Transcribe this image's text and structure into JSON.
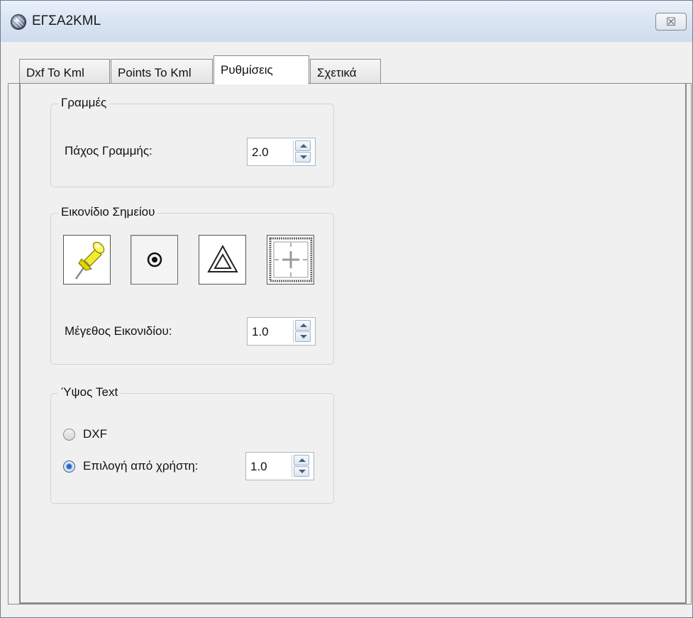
{
  "window": {
    "title": "ΕΓΣΑ2KML",
    "close_glyph": "☒"
  },
  "tabs": [
    {
      "label": "Dxf To Kml",
      "active": false
    },
    {
      "label": "Points To Kml",
      "active": false
    },
    {
      "label": "Ρυθμίσεις",
      "active": true
    },
    {
      "label": "Σχετικά",
      "active": false
    }
  ],
  "lines_group": {
    "title": "Γραμμές",
    "thickness_label": "Πάχος Γραμμής:",
    "thickness_value": "2.0"
  },
  "point_icon_group": {
    "title": "Εικονίδιο Σημείου",
    "icons": [
      {
        "name": "pushpin-icon",
        "selected": false
      },
      {
        "name": "target-dot-icon",
        "selected": true
      },
      {
        "name": "triangle-icon",
        "selected": false
      },
      {
        "name": "crosshair-icon",
        "selected": false
      }
    ],
    "size_label": "Μέγεθος Εικονιδίου:",
    "size_value": "1.0"
  },
  "text_height_group": {
    "title": "Ύψος Text",
    "option_dxf": "DXF",
    "option_user": "Επιλογή από χρήστη:",
    "selected": "user",
    "user_value": "1.0"
  }
}
